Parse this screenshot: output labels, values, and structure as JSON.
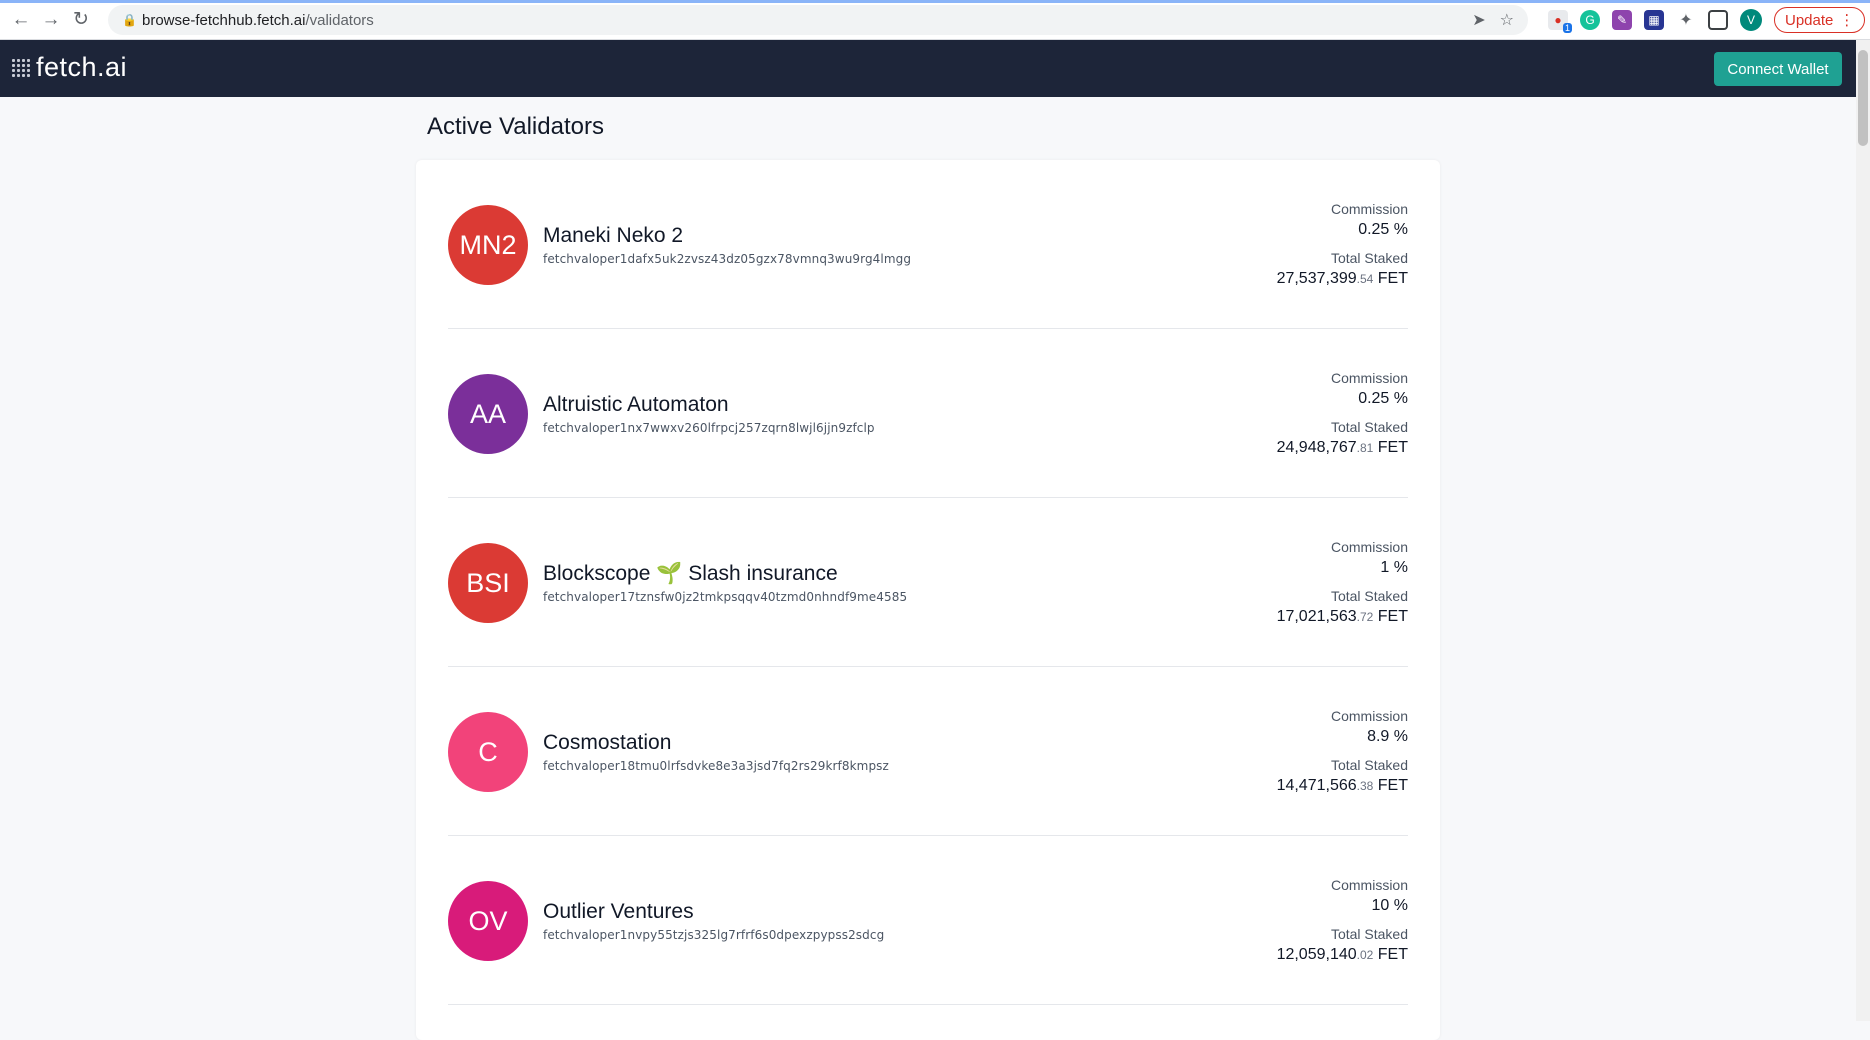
{
  "browser": {
    "url_host": "browse-fetchhub.fetch.ai",
    "url_path": "/validators",
    "update_label": "Update",
    "profile_initial": "V",
    "ext_badge": "1"
  },
  "header": {
    "logo_text": "fetch.ai",
    "connect_label": "Connect Wallet"
  },
  "page": {
    "title": "Active Validators"
  },
  "labels": {
    "commission": "Commission",
    "total_staked": "Total Staked",
    "unit": "FET"
  },
  "validators": [
    {
      "initials": "MN2",
      "name": "Maneki Neko 2",
      "address": "fetchvaloper1dafx5uk2zvsz43dz05gzx78vmnq3wu9rg4lmgg",
      "commission": "0.25 %",
      "staked_int": "27,537,399",
      "staked_dec": ".54",
      "color": "#db3a34"
    },
    {
      "initials": "AA",
      "name": "Altruistic Automaton",
      "address": "fetchvaloper1nx7wwxv260lfrpcj257zqrn8lwjl6jjn9zfclp",
      "commission": "0.25 %",
      "staked_int": "24,948,767",
      "staked_dec": ".81",
      "color": "#7b2f9a"
    },
    {
      "initials": "BSI",
      "name": "Blockscope 🌱 Slash insurance",
      "address": "fetchvaloper17tznsfw0jz2tmkpsqqv40tzmd0nhndf9me4585",
      "commission": "1 %",
      "staked_int": "17,021,563",
      "staked_dec": ".72",
      "color": "#db3a34"
    },
    {
      "initials": "C",
      "name": "Cosmostation",
      "address": "fetchvaloper18tmu0lrfsdvke8e3a3jsd7fq2rs29krf8kmpsz",
      "commission": "8.9 %",
      "staked_int": "14,471,566",
      "staked_dec": ".38",
      "color": "#f2437a"
    },
    {
      "initials": "OV",
      "name": "Outlier Ventures",
      "address": "fetchvaloper1nvpy55tzjs325lg7rfrf6s0dpexzpypss2sdcg",
      "commission": "10 %",
      "staked_int": "12,059,140",
      "staked_dec": ".02",
      "color": "#d81b7a"
    }
  ]
}
